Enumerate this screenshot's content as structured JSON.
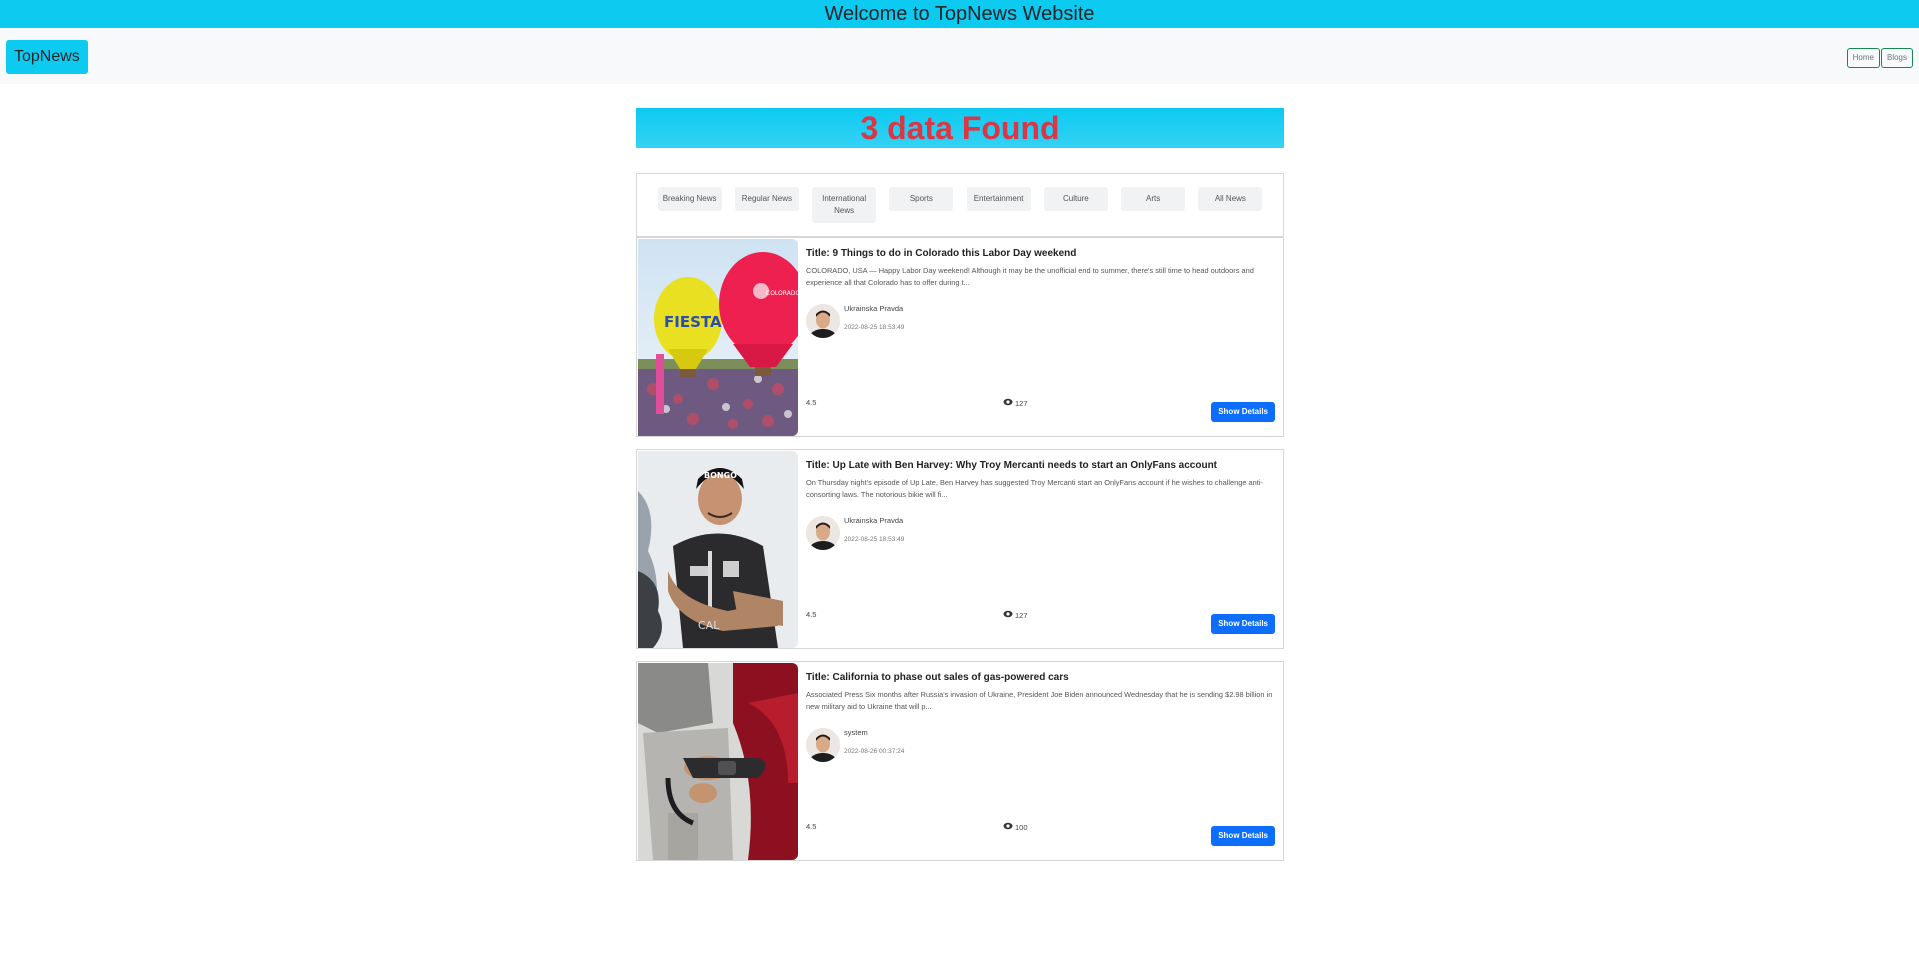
{
  "header": {
    "welcome": "Welcome to TopNews Website"
  },
  "navbar": {
    "brand": "TopNews",
    "home": "Home",
    "blogs": "Blogs"
  },
  "results": {
    "found_text": "3 data Found"
  },
  "categories": [
    "Breaking News",
    "Regular News",
    "International News",
    "Sports",
    "Entertainment",
    "Culture",
    "Arts",
    "All News"
  ],
  "articles": [
    {
      "title": "Title: 9 Things to do in Colorado this Labor Day weekend",
      "description": "COLORADO, USA — Happy Labor Day weekend! Although it may be the unofficial end to summer, there's still time to head outdoors and experience all that Colorado has to offer during t...",
      "author": "Ukrainska Pravda",
      "date": "2022-08-25 18:53:49",
      "rating": "4.5",
      "views": "127",
      "button": "Show Details"
    },
    {
      "title": "Title: Up Late with Ben Harvey: Why Troy Mercanti needs to start an OnlyFans account",
      "description": "On Thursday night's episode of Up Late, Ben Harvey has suggested Troy Mercanti start an OnlyFans account if he wishes to challenge anti-consorting laws. The notorious bikie will fi...",
      "author": "Ukrainska Pravda",
      "date": "2022-08-25 18:53:49",
      "rating": "4.5",
      "views": "127",
      "button": "Show Details"
    },
    {
      "title": "Title: California to phase out sales of gas-powered cars",
      "description": "Associated Press Six months after Russia's invasion of Ukraine, President Joe Biden announced Wednesday that he is sending $2.98 billion in new military aid to Ukraine that will p...",
      "author": "system",
      "date": "2022-08-26 00:37:24",
      "rating": "4.5",
      "views": "100",
      "button": "Show Details"
    }
  ],
  "colors": {
    "accent": "#0dcaf0",
    "found_text": "#dc3545",
    "button": "#0d6efd",
    "nav_outline": "#198754"
  }
}
